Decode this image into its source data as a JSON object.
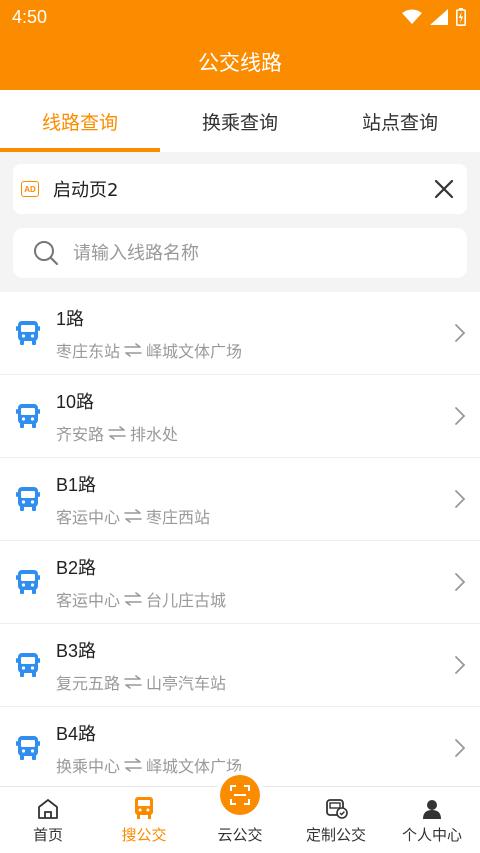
{
  "status": {
    "time": "4:50"
  },
  "header": {
    "title": "公交线路"
  },
  "tabs": [
    {
      "label": "线路查询",
      "active": true
    },
    {
      "label": "换乘查询",
      "active": false
    },
    {
      "label": "站点查询",
      "active": false
    }
  ],
  "ad": {
    "badge": "AD",
    "text": "启动页2"
  },
  "search": {
    "placeholder": "请输入线路名称",
    "value": ""
  },
  "routes": [
    {
      "name": "1路",
      "from": "枣庄东站",
      "to": "峄城文体广场"
    },
    {
      "name": "10路",
      "from": "齐安路",
      "to": "排水处"
    },
    {
      "name": "B1路",
      "from": "客运中心",
      "to": "枣庄西站"
    },
    {
      "name": "B2路",
      "from": "客运中心",
      "to": "台儿庄古城"
    },
    {
      "name": "B3路",
      "from": "复元五路",
      "to": "山亭汽车站"
    },
    {
      "name": "B4路",
      "from": "换乘中心",
      "to": "峄城文体广场"
    }
  ],
  "nav": [
    {
      "label": "首页",
      "icon": "home-icon"
    },
    {
      "label": "搜公交",
      "icon": "bus-icon",
      "active": true
    },
    {
      "label": "云公交",
      "icon": "scan-icon"
    },
    {
      "label": "定制公交",
      "icon": "custom-bus-icon"
    },
    {
      "label": "个人中心",
      "icon": "person-icon"
    }
  ],
  "colors": {
    "accent": "#fb8c00",
    "route_icon": "#2f8ef0"
  }
}
